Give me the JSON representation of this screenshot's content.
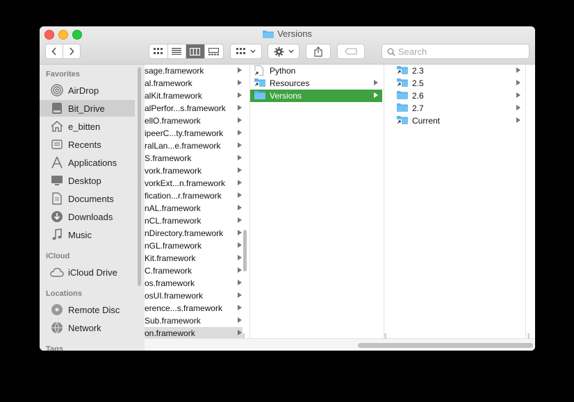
{
  "window": {
    "title": "Versions"
  },
  "toolbar": {
    "back_icon": "chevron-left-icon",
    "forward_icon": "chevron-right-icon",
    "view_modes": [
      "icon-view",
      "list-view",
      "column-view",
      "gallery-view"
    ],
    "active_view": "column-view",
    "search_placeholder": "Search"
  },
  "sidebar": {
    "sections": {
      "favorites": "Favorites",
      "icloud": "iCloud",
      "locations": "Locations",
      "tags": "Tags"
    },
    "favorites": [
      {
        "label": "AirDrop",
        "icon": "airdrop-icon"
      },
      {
        "label": "Bit_Drive",
        "icon": "drive-icon",
        "selected": true
      },
      {
        "label": "e_bitten",
        "icon": "home-icon"
      },
      {
        "label": "Recents",
        "icon": "recents-icon"
      },
      {
        "label": "Applications",
        "icon": "applications-icon"
      },
      {
        "label": "Desktop",
        "icon": "desktop-icon"
      },
      {
        "label": "Documents",
        "icon": "documents-icon"
      },
      {
        "label": "Downloads",
        "icon": "downloads-icon"
      },
      {
        "label": "Music",
        "icon": "music-icon"
      }
    ],
    "icloud": [
      {
        "label": "iCloud Drive",
        "icon": "cloud-icon"
      }
    ],
    "locations": [
      {
        "label": "Remote Disc",
        "icon": "disc-icon"
      },
      {
        "label": "Network",
        "icon": "network-icon"
      }
    ]
  },
  "columns": {
    "frameworks": [
      "sage.framework",
      "al.framework",
      "alKit.framework",
      "alPerfor...s.framework",
      "ellO.framework",
      "ipeerC...ty.framework",
      "ralLan...e.framework",
      "S.framework",
      "vork.framework",
      "vorkExt...n.framework",
      "fication...r.framework",
      "nAL.framework",
      "nCL.framework",
      "nDirectory.framework",
      "nGL.framework",
      "Kit.framework",
      "C.framework",
      "os.framework",
      "osUI.framework",
      "erence...s.framework",
      "Sub.framework",
      "on.framework"
    ],
    "python": [
      {
        "label": "Python",
        "kind": "alias-file"
      },
      {
        "label": "Resources",
        "kind": "alias-folder"
      },
      {
        "label": "Versions",
        "kind": "folder",
        "selected": true
      }
    ],
    "versions": [
      {
        "label": "2.3",
        "kind": "folder"
      },
      {
        "label": "2.5",
        "kind": "folder"
      },
      {
        "label": "2.6",
        "kind": "folder"
      },
      {
        "label": "2.7",
        "kind": "folder"
      },
      {
        "label": "Current",
        "kind": "alias-folder"
      }
    ]
  },
  "colors": {
    "selection": "#3fa240",
    "folder": "#5bb5ef",
    "sidebar_bg": "#e8e8e8"
  }
}
